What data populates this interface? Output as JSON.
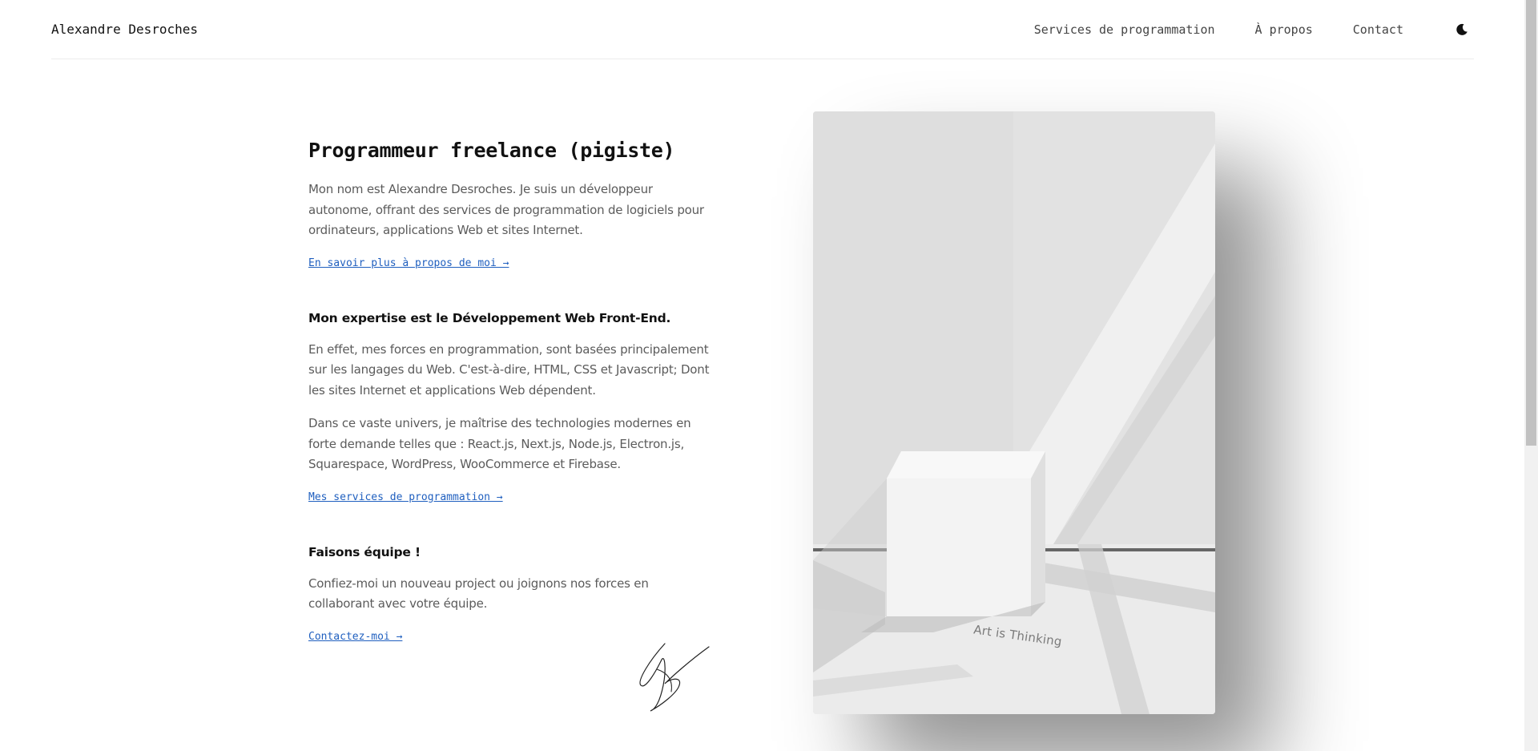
{
  "header": {
    "brand": "Alexandre Desroches",
    "nav": [
      {
        "label": "Services de programmation"
      },
      {
        "label": "À propos"
      },
      {
        "label": "Contact"
      }
    ],
    "theme_toggle_icon": "moon-icon"
  },
  "intro": {
    "title": "Programmeur freelance (pigiste)",
    "text": "Mon nom est Alexandre Desroches. Je suis un développeur autonome, offrant des services de programmation de logiciels pour ordinateurs, applications Web et sites Internet.",
    "link": "En savoir plus à propos de moi →"
  },
  "expertise": {
    "heading": "Mon expertise est le Développement Web Front-End.",
    "text1": "En effet, mes forces en programmation, sont basées principalement sur les langages du Web. C'est-à-dire, HTML, CSS et Javascript; Dont les sites Internet et applications Web dépendent.",
    "text2": "Dans ce vaste univers, je maîtrise des technologies modernes en forte demande telles que : React.js, Next.js, Node.js, Electron.js, Squarespace, WordPress, WooCommerce et Firebase.",
    "link": "Mes services de programmation →"
  },
  "team": {
    "heading": "Faisons équipe !",
    "text": "Confiez-moi un nouveau project ou joignons nos forces en collaborant avec votre équipe.",
    "link": "Contactez-moi →"
  },
  "photo": {
    "caption": "Art is Thinking"
  },
  "colors": {
    "link": "#1f5fbf",
    "text": "#5b5b5b",
    "heading": "#111111"
  }
}
